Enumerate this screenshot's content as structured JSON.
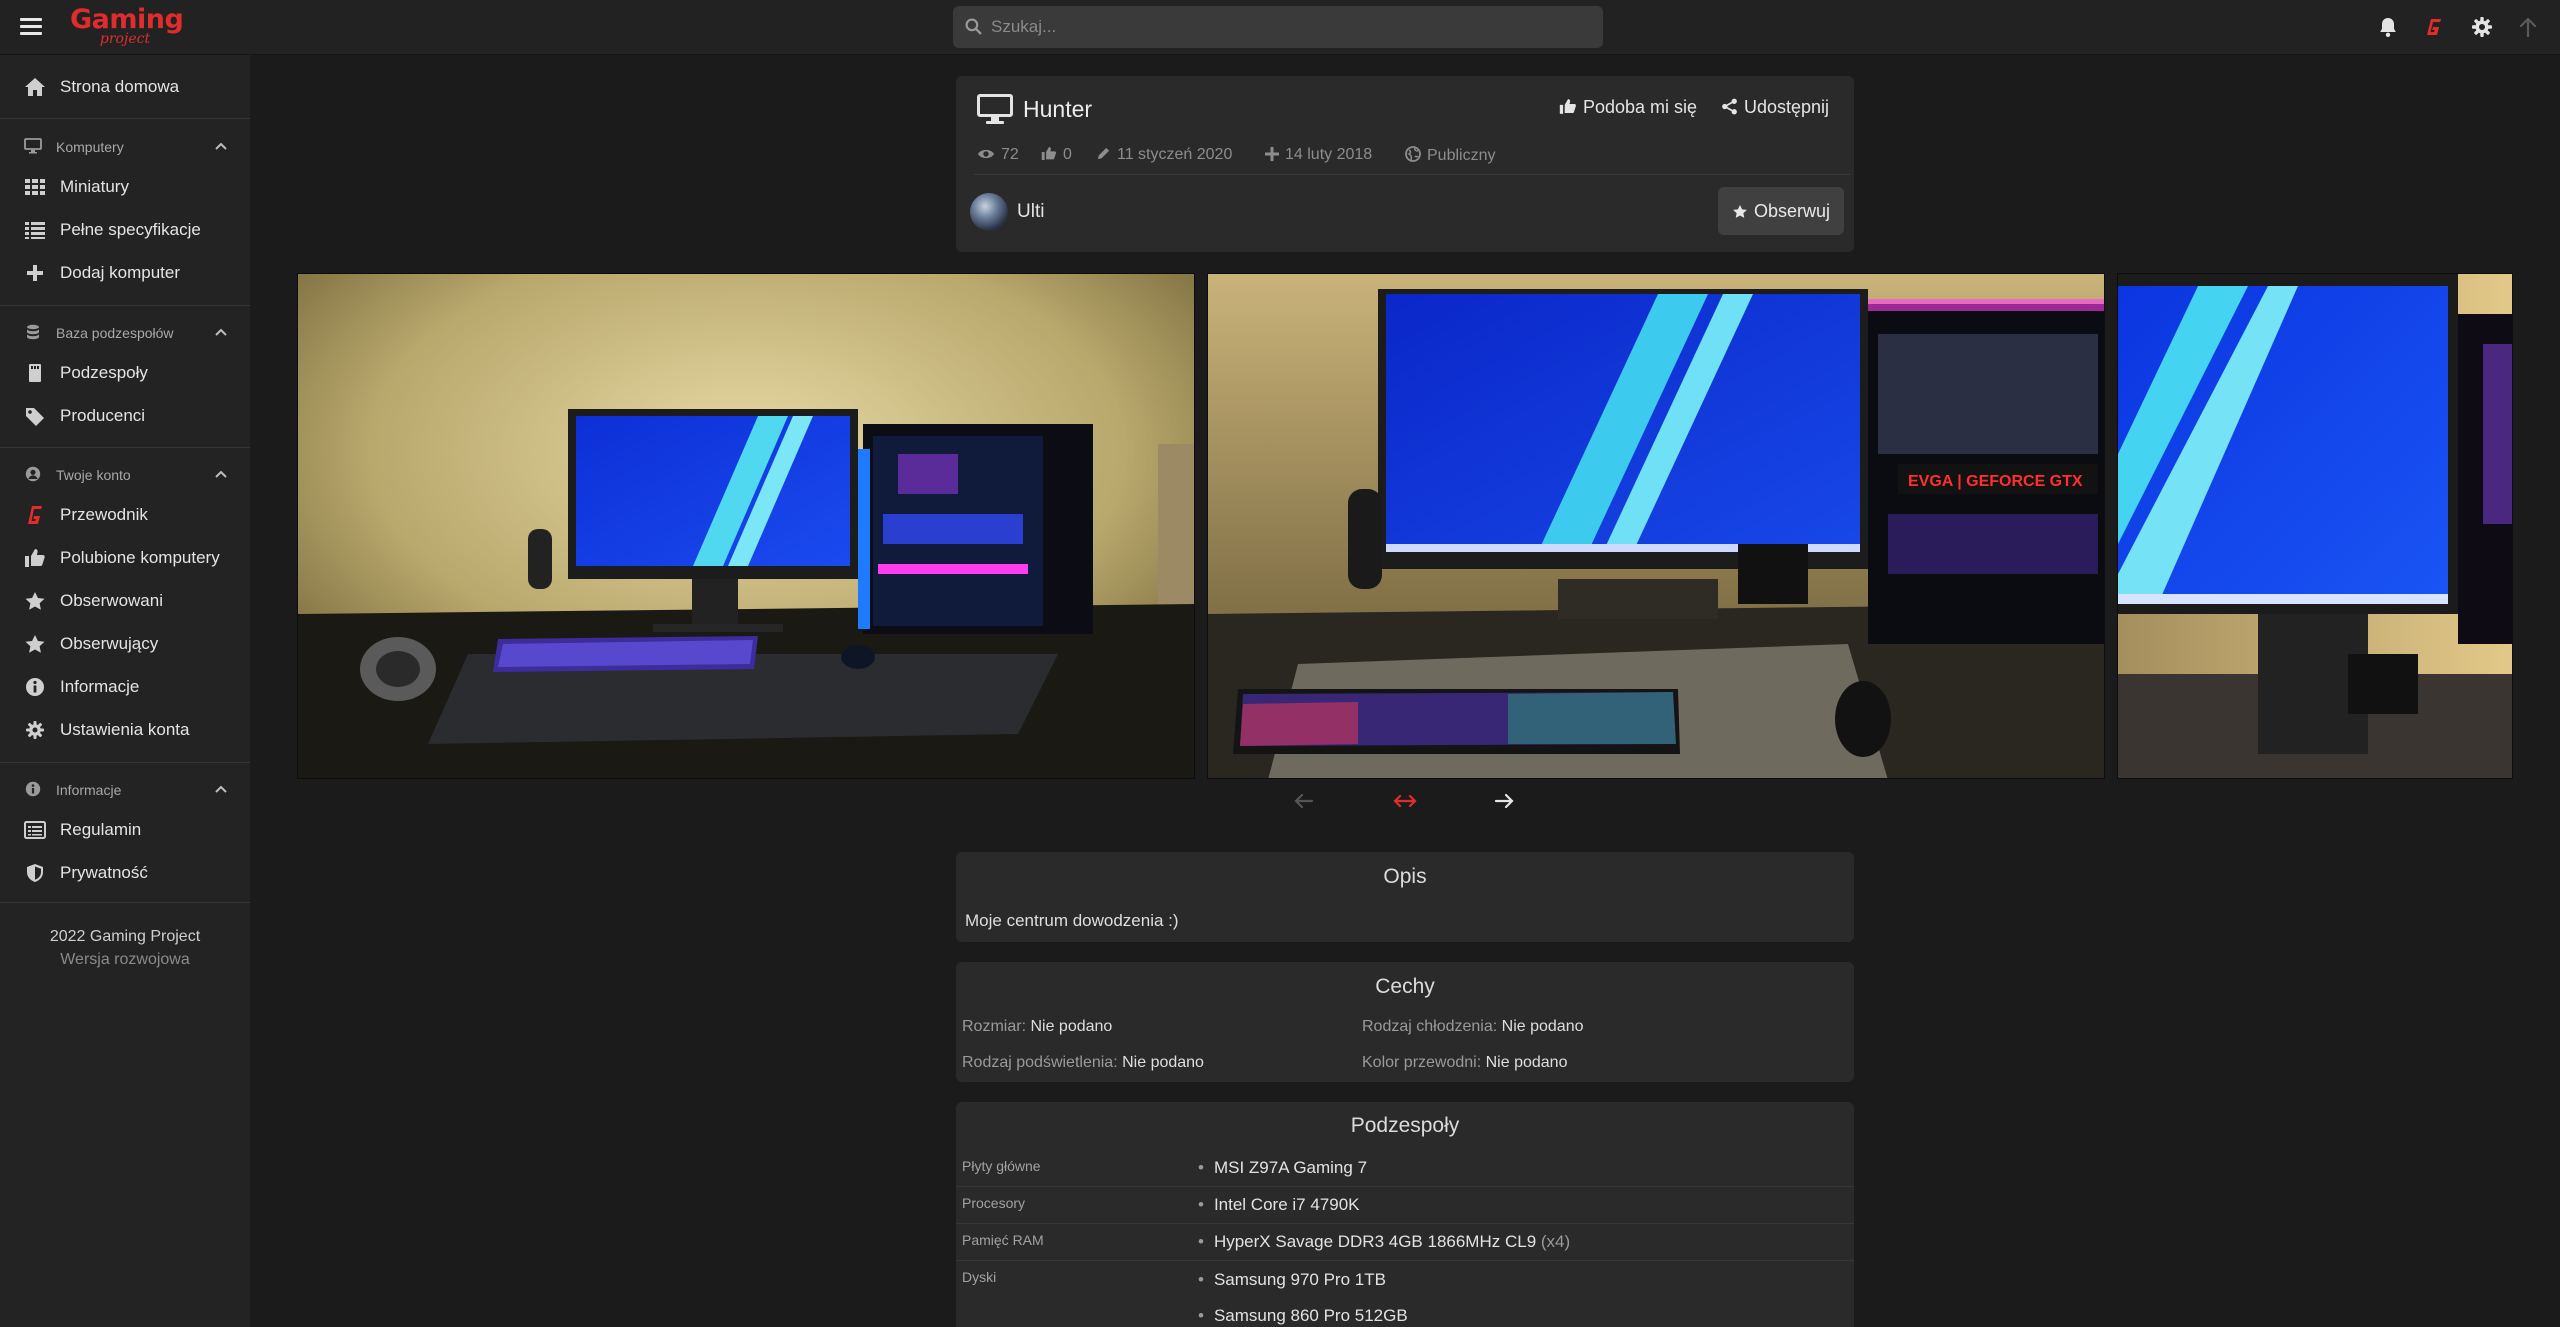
{
  "header": {
    "logo_main": "Gaming",
    "logo_sub": "project",
    "search_placeholder": "Szukaj...",
    "icons": [
      "menu-icon",
      "bell-icon",
      "gp-logo-icon",
      "gear-icon",
      "arrow-up-icon"
    ]
  },
  "sidebar": {
    "home": "Strona domowa",
    "sections": [
      {
        "title": "Komputery",
        "items": [
          "Miniatury",
          "Pełne specyfikacje",
          "Dodaj komputer"
        ]
      },
      {
        "title": "Baza podzespołów",
        "items": [
          "Podzespoły",
          "Producenci"
        ]
      },
      {
        "title": "Twoje konto",
        "items": [
          "Przewodnik",
          "Polubione komputery",
          "Obserwowani",
          "Obserwujący",
          "Informacje",
          "Ustawienia konta"
        ]
      },
      {
        "title": "Informacje",
        "items": [
          "Regulamin",
          "Prywatność"
        ]
      }
    ],
    "footer_line1": "2022 Gaming Project",
    "footer_line2": "Wersja rozwojowa"
  },
  "computer": {
    "name": "Hunter",
    "like_label": "Podoba mi się",
    "share_label": "Udostępnij",
    "views": "72",
    "likes": "0",
    "edited": "11 styczeń 2020",
    "created": "14 luty 2018",
    "visibility": "Publiczny",
    "owner": "Ulti",
    "follow_label": "Obserwuj"
  },
  "description": {
    "title": "Opis",
    "text": "Moje centrum dowodzenia :)"
  },
  "features": {
    "title": "Cechy",
    "size_label": "Rozmiar:",
    "size_value": "Nie podano",
    "cooling_label": "Rodzaj chłodzenia:",
    "cooling_value": "Nie podano",
    "lighting_label": "Rodzaj podświetlenia:",
    "lighting_value": "Nie podano",
    "wire_label": "Kolor przewodni:",
    "wire_value": "Nie podano"
  },
  "components": {
    "title": "Podzespoły",
    "rows": [
      {
        "category": "Płyty główne",
        "items": [
          "MSI Z97A Gaming 7"
        ]
      },
      {
        "category": "Procesory",
        "items": [
          "Intel Core i7 4790K"
        ]
      },
      {
        "category": "Pamięć RAM",
        "items": [
          "HyperX Savage DDR3 4GB 1866MHz CL9"
        ],
        "qty": "(x4)"
      },
      {
        "category": "Dyski",
        "items": [
          "Samsung 970 Pro 1TB",
          "Samsung 860 Pro 512GB"
        ]
      }
    ]
  },
  "gallery": {
    "photo_count": 3,
    "photo_overlay_text": "EVGA | GEFORCE GTX"
  },
  "colors": {
    "background": "#1b1b1b",
    "panel": "#2a2a2a",
    "sidebar": "#232323",
    "brand_red": "#e02c2c"
  }
}
